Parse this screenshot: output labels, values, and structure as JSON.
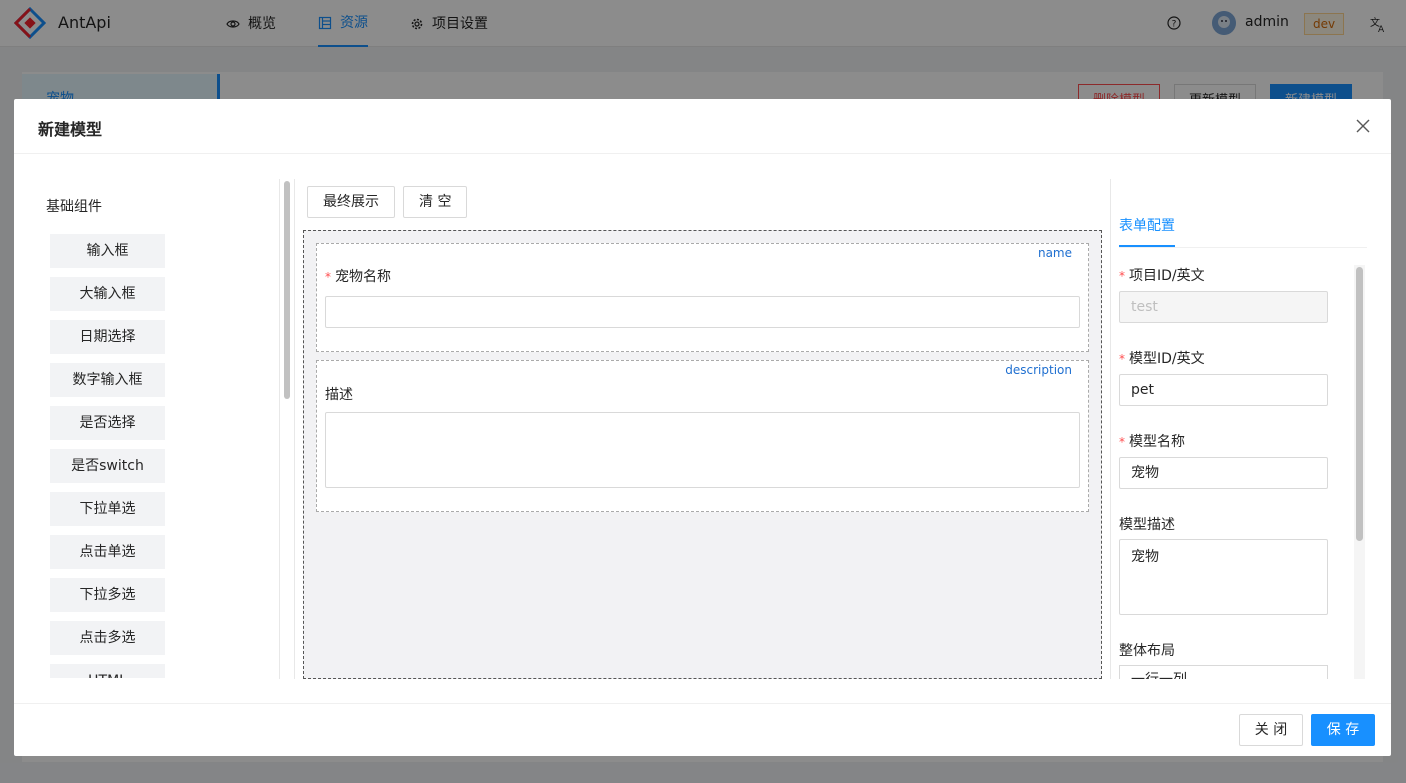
{
  "app": {
    "brand": "AntApi",
    "user": "admin",
    "env": "dev"
  },
  "nav": [
    {
      "label": "概览",
      "icon": "eye-icon"
    },
    {
      "label": "资源",
      "icon": "table-icon",
      "active": true
    },
    {
      "label": "项目设置",
      "icon": "gear-icon"
    }
  ],
  "background": {
    "tab": "宠物",
    "buttons": [
      "删除模型",
      "更新模型",
      "新建模型"
    ]
  },
  "modal": {
    "title": "新建模型",
    "palette_title": "基础组件",
    "components": [
      "输入框",
      "大输入框",
      "日期选择",
      "数字输入框",
      "是否选择",
      "是否switch",
      "下拉单选",
      "点击单选",
      "下拉多选",
      "点击多选",
      "HTML"
    ],
    "toolbar": {
      "preview": "最终展示",
      "clear": "清 空"
    },
    "fields": [
      {
        "key": "name",
        "label": "宠物名称",
        "required": true
      },
      {
        "key": "description",
        "label": "描述",
        "required": false
      }
    ],
    "config": {
      "tab": "表单配置",
      "project_id_label": "项目ID/英文",
      "project_id_value": "test",
      "model_id_label": "模型ID/英文",
      "model_id_value": "pet",
      "model_name_label": "模型名称",
      "model_name_value": "宠物",
      "model_desc_label": "模型描述",
      "model_desc_value": "宠物",
      "layout_label": "整体布局",
      "layout_value": "一行一列"
    },
    "footer": {
      "close": "关 闭",
      "save": "保 存"
    }
  },
  "colors": {
    "primary": "#1890ff",
    "danger": "#ff4d4f",
    "mask": "rgba(0,0,0,0.45)"
  }
}
